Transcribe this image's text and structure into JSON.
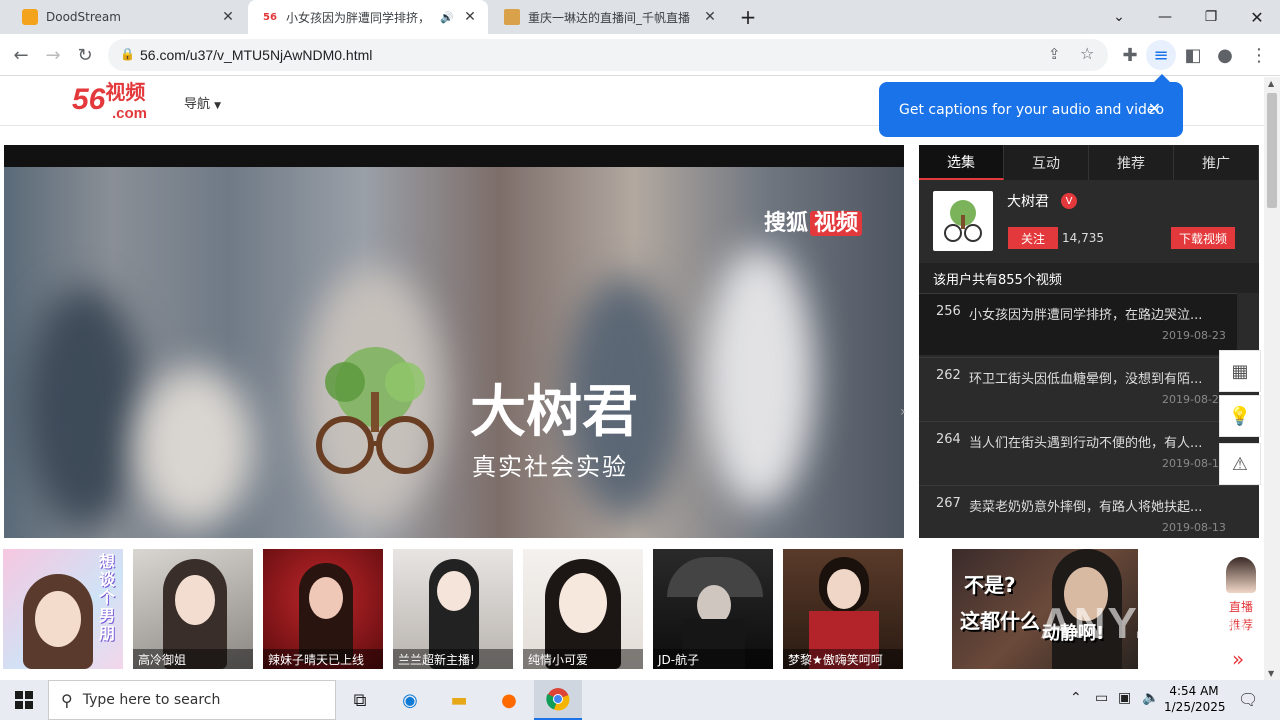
{
  "browser": {
    "tabs": [
      {
        "title": "DoodStream",
        "icon": "doodstream-icon",
        "active": false
      },
      {
        "title": "小女孩因为胖遭同学排挤，",
        "icon": "56-icon",
        "active": true
      },
      {
        "title": "重庆一琳达的直播间_千帆直播",
        "icon": "qianfan-icon",
        "active": false
      }
    ],
    "new_tab_label": "+",
    "url": "56.com/u37/v_MTU5NjAwNDM0.html",
    "caption_bubble": "Get captions for your audio and video"
  },
  "site": {
    "logo_num": "56",
    "logo_cn": "视频",
    "logo_dom": ".com",
    "nav_label": "导航"
  },
  "player": {
    "watermark_brand": "搜狐",
    "watermark_tag": "视频",
    "channel_name": "大树君",
    "slogan": "真实社会实验"
  },
  "panel": {
    "tabs": [
      "选集",
      "互动",
      "推荐",
      "推广"
    ],
    "uploader": "大树君",
    "verified": "V",
    "follow_label": "关注",
    "followers": "14,735",
    "download_label": "下载视频",
    "video_count_text": "该用户共有855个视频",
    "videos": [
      {
        "num": "256",
        "title": "小女孩因为胖遭同学排挤，在路边哭泣...",
        "date": "2019-08-23"
      },
      {
        "num": "262",
        "title": "环卫工街头因低血糖晕倒，没想到有陌...",
        "date": "2019-08-2"
      },
      {
        "num": "264",
        "title": "当人们在街头遇到行动不便的他，有人...",
        "date": "2019-08-1"
      },
      {
        "num": "267",
        "title": "卖菜老奶奶意外摔倒，有路人将她扶起...",
        "date": "2019-08-13"
      }
    ]
  },
  "live": {
    "thumbs": [
      {
        "name": "",
        "side_text": "想谈个男朋"
      },
      {
        "name": "高冷御姐"
      },
      {
        "name": "辣妹子晴天已上线"
      },
      {
        "name": "兰兰超新主播!"
      },
      {
        "name": "纯情小可爱"
      },
      {
        "name": "JD-航子"
      },
      {
        "name": "梦黎★傲嗨笑呵呵"
      }
    ],
    "big_thumb_line1": "不是?",
    "big_thumb_line2": "这都什么",
    "big_thumb_line3": "动静啊!",
    "side_label": "直播推荐",
    "side_arrow": "»"
  },
  "taskbar": {
    "search_placeholder": "Type here to search",
    "time": "4:54 AM",
    "date": "1/25/2025"
  },
  "watermark": "ANY.RUN"
}
